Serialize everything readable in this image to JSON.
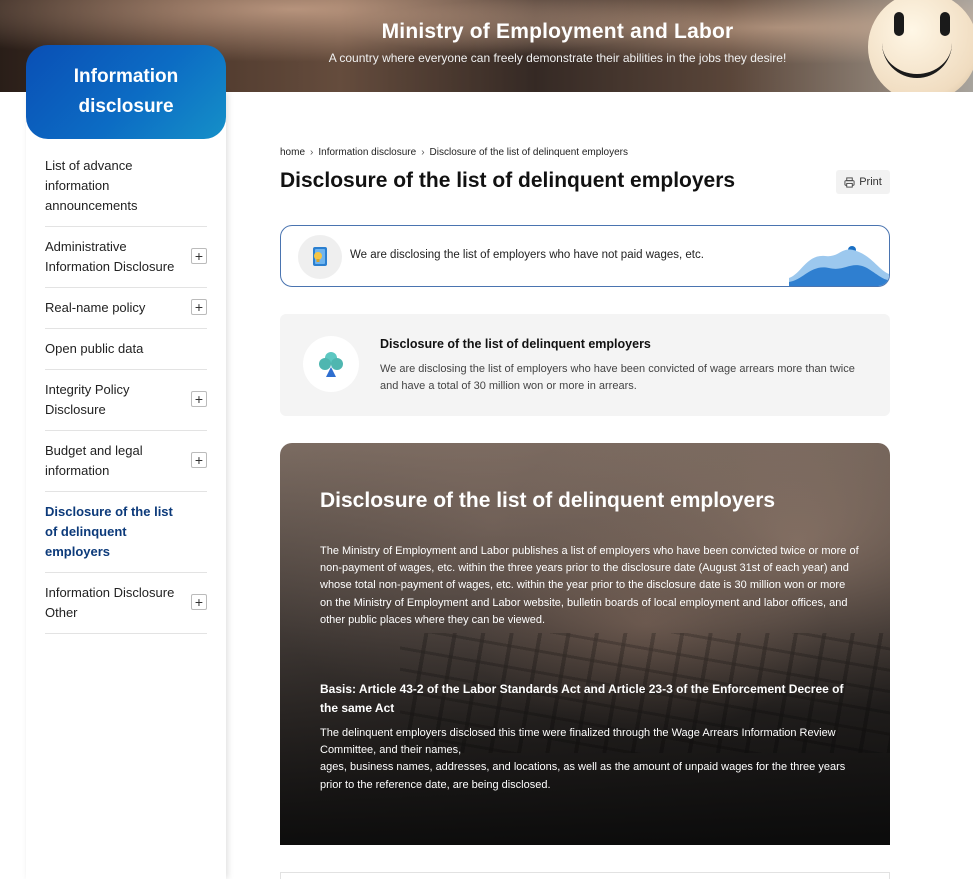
{
  "header": {
    "title": "Ministry of Employment and Labor",
    "subtitle": "A country where everyone can freely demonstrate their abilities in the jobs they desire!"
  },
  "sidebar": {
    "heading": "Information disclosure",
    "items": [
      {
        "label": "List of advance information announcements",
        "expandable": false,
        "active": false
      },
      {
        "label": "Administrative Information Disclosure",
        "expandable": true,
        "active": false
      },
      {
        "label": "Real-name policy",
        "expandable": true,
        "active": false
      },
      {
        "label": "Open public data",
        "expandable": false,
        "active": false
      },
      {
        "label": "Integrity Policy Disclosure",
        "expandable": true,
        "active": false
      },
      {
        "label": "Budget and legal information",
        "expandable": true,
        "active": false
      },
      {
        "label": "Disclosure of the list of delinquent employers",
        "expandable": false,
        "active": true
      },
      {
        "label": "Information Disclosure Other",
        "expandable": true,
        "active": false
      }
    ],
    "expand_symbol": "+"
  },
  "breadcrumb": [
    "home",
    "Information disclosure",
    "Disclosure of the list of delinquent employers"
  ],
  "breadcrumb_sep": "›",
  "page": {
    "title": "Disclosure of the list of delinquent employers",
    "print_label": "Print"
  },
  "notice": {
    "text": "We are disclosing the list of employers who have not paid wages, etc."
  },
  "summary": {
    "title": "Disclosure of the list of delinquent employers",
    "text": "We are disclosing the list of employers who have been convicted of wage arrears more than twice and have a total of 30 million won or more in arrears."
  },
  "hero": {
    "title": "Disclosure of the list of delinquent employers",
    "paragraph_lines": [
      "The Ministry of Employment and Labor publishes a list of employers who have been convicted twice or more of non-payment of wages, etc. within the three years prior to the disclosure date (August 31st of each year) and whose total non-payment of wages, etc. within the year prior to the disclosure date is 30 million won or more",
      "on the Ministry of Employment and Labor website, bulletin boards of local employment and labor offices, and other public places where they can be viewed."
    ],
    "basis": "Basis: Article 43-2 of the Labor Standards Act and Article 23-3 of the Enforcement Decree of the same Act",
    "detail_lines": [
      "The delinquent employers disclosed this time were finalized through the Wage Arrears Information Review Committee, and their names,",
      "ages, business names, addresses, and locations, as well as the amount of unpaid wages for the three years prior to the reference date, are being disclosed."
    ]
  },
  "colors": {
    "accent": "#0c3a7a",
    "sidebar_gradient_start": "#0a4fb5",
    "sidebar_gradient_end": "#1590c8",
    "notice_border": "#4a74b0"
  },
  "icons": {
    "notice": "book-lightbulb-icon",
    "summary": "club-tree-icon",
    "print": "printer-icon"
  }
}
